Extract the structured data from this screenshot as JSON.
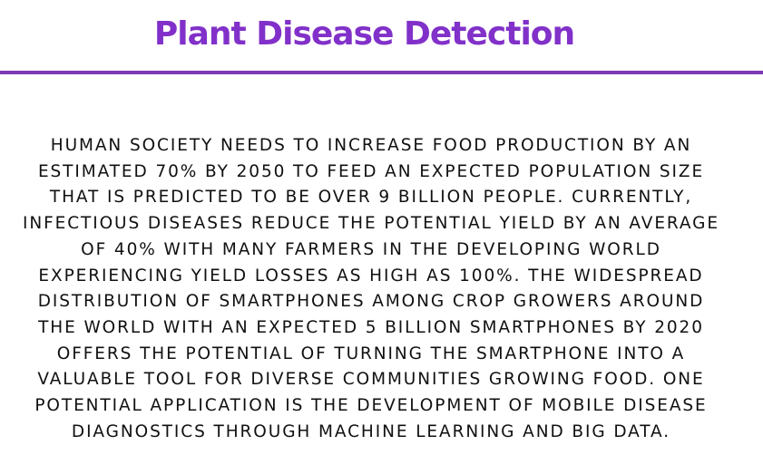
{
  "header": {
    "title": "Plant Disease Detection"
  },
  "colors": {
    "accent": "#8131c9",
    "rule": "#7e3bb5",
    "text": "#111111",
    "background": "#ffffff"
  },
  "description": {
    "lines": [
      "HUMAN SOCIETY NEEDS TO INCREASE FOOD PRODUCTION BY AN",
      "ESTIMATED 70% BY 2050 TO FEED AN EXPECTED POPULATION SIZE",
      "THAT IS PREDICTED TO BE OVER 9 BILLION PEOPLE. CURRENTLY,",
      "INFECTIOUS DISEASES REDUCE THE POTENTIAL YIELD BY AN AVERAGE",
      "OF 40% WITH MANY FARMERS IN THE DEVELOPING WORLD",
      "EXPERIENCING YIELD LOSSES AS HIGH AS 100%. THE WIDESPREAD",
      "DISTRIBUTION OF SMARTPHONES AMONG CROP GROWERS AROUND",
      "THE WORLD WITH AN EXPECTED 5 BILLION SMARTPHONES BY 2020",
      "OFFERS THE POTENTIAL OF TURNING THE SMARTPHONE INTO A",
      "VALUABLE TOOL FOR DIVERSE COMMUNITIES GROWING FOOD. ONE",
      "POTENTIAL APPLICATION IS THE DEVELOPMENT OF MOBILE DISEASE",
      "DIAGNOSTICS THROUGH MACHINE LEARNING AND BIG DATA."
    ]
  }
}
